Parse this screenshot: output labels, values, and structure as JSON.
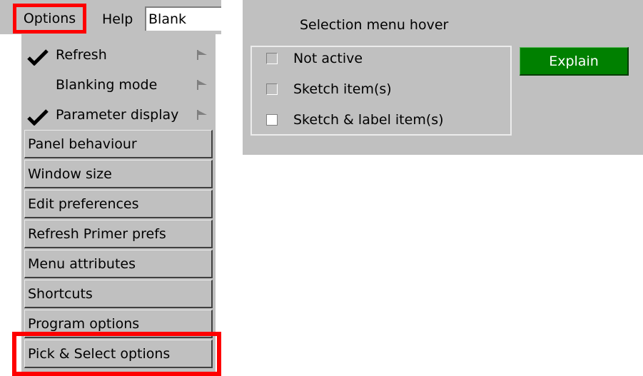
{
  "menubar": {
    "options_label": "Options",
    "help_label": "Help",
    "field_value": "Blank"
  },
  "dropdown": {
    "toggles": [
      {
        "label": "Refresh",
        "checked": true
      },
      {
        "label": "Blanking mode",
        "checked": false
      },
      {
        "label": "Parameter display",
        "checked": true
      }
    ],
    "buttons": [
      "Panel behaviour",
      "Window size",
      "Edit preferences",
      "Refresh Primer prefs",
      "Menu attributes",
      "Shortcuts",
      "Program options",
      "Pick & Select options"
    ]
  },
  "panel": {
    "title": "Selection menu hover",
    "options": [
      {
        "label": "Not active",
        "selected": false
      },
      {
        "label": "Sketch item(s)",
        "selected": false
      },
      {
        "label": "Sketch & label item(s)",
        "selected": true
      }
    ],
    "explain_label": "Explain"
  },
  "colors": {
    "highlight": "#ff0000",
    "explain_bg": "#008000",
    "panel_bg": "#c0c0c0"
  }
}
